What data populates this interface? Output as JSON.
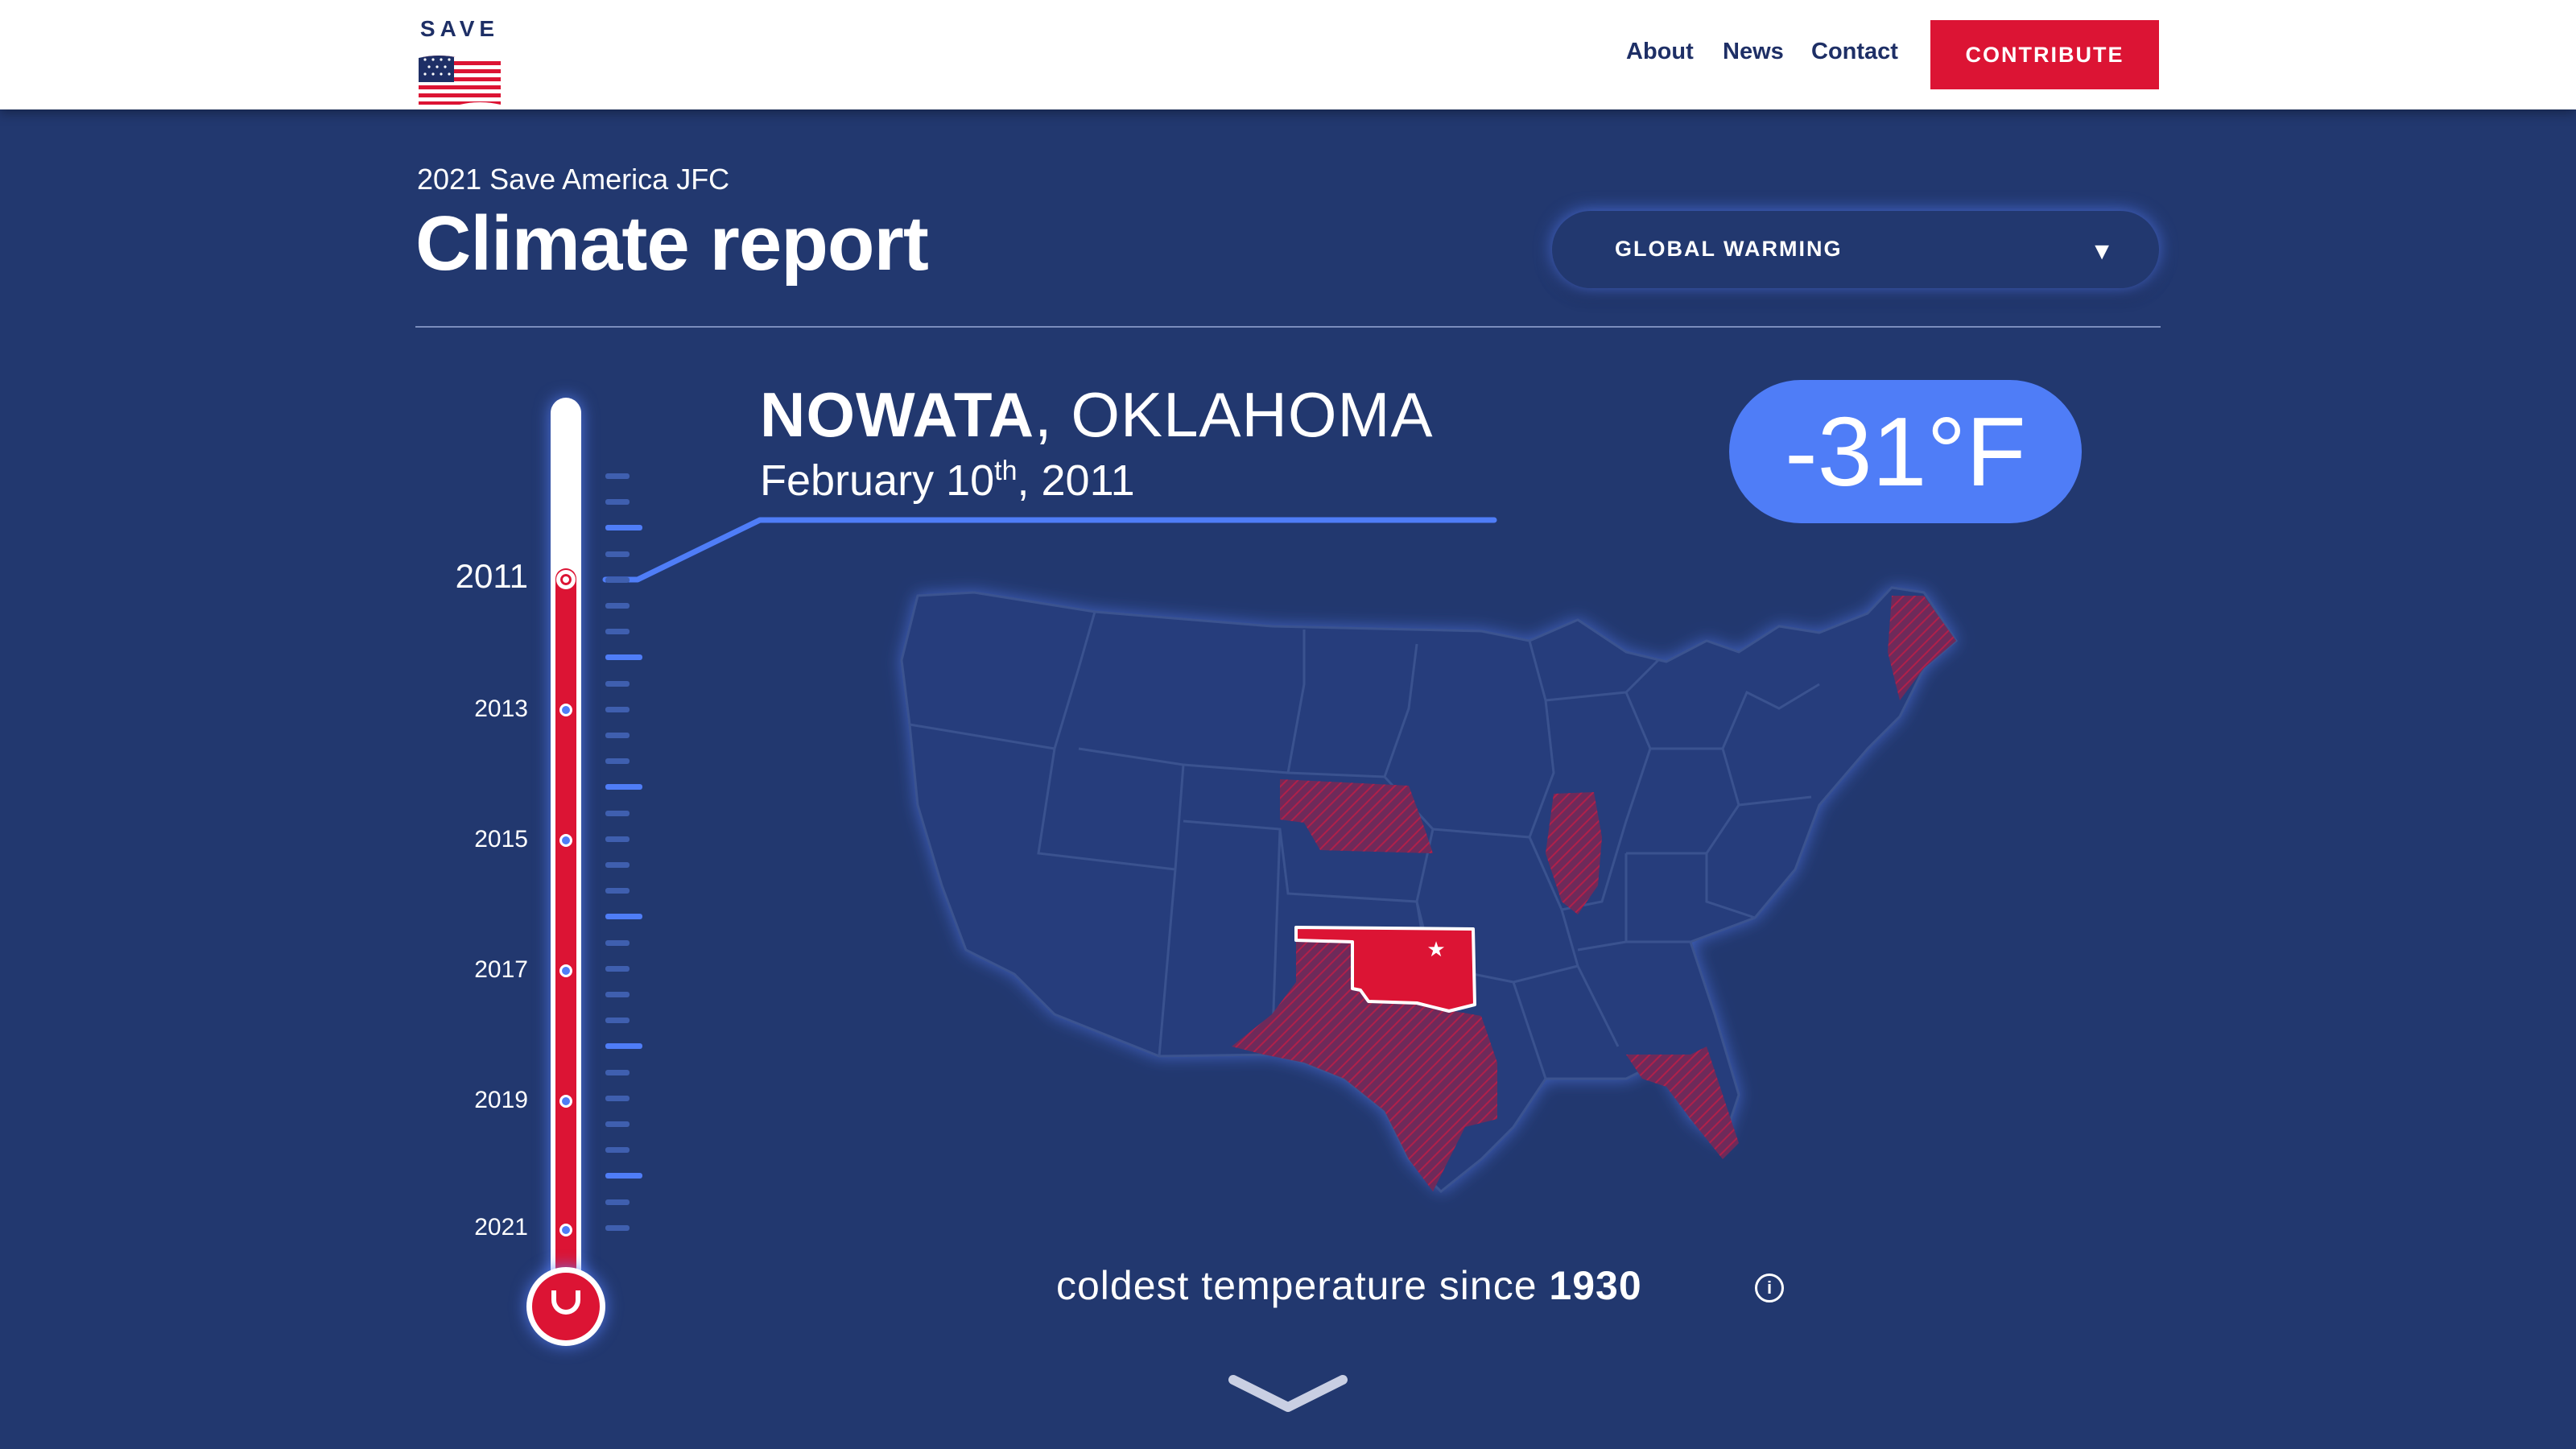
{
  "header": {
    "logo_text": "SAVE",
    "nav": [
      "About",
      "News",
      "Contact"
    ],
    "contribute_label": "CONTRIBUTE"
  },
  "page": {
    "subtitle": "2021 Save America JFC",
    "title": "Climate report",
    "dropdown_selected": "GLOBAL WARMING"
  },
  "record": {
    "city": "NOWATA",
    "state": ", OKLAHOMA",
    "date_main": "February 10",
    "date_suffix": "th",
    "date_year": ", 2011",
    "temperature": "-31°F",
    "caption_prefix": "coldest temperature since ",
    "caption_year": "1930"
  },
  "timeline": {
    "selected_year": "2011",
    "years": [
      "2011",
      "2013",
      "2015",
      "2017",
      "2019",
      "2021"
    ]
  },
  "colors": {
    "background": "#22386f",
    "accent_blue": "#4f7df7",
    "accent_red": "#dc1434"
  },
  "icons": {
    "info": "info-icon",
    "scroll": "chevron-down-icon",
    "dropdown": "triangle-down-icon"
  }
}
